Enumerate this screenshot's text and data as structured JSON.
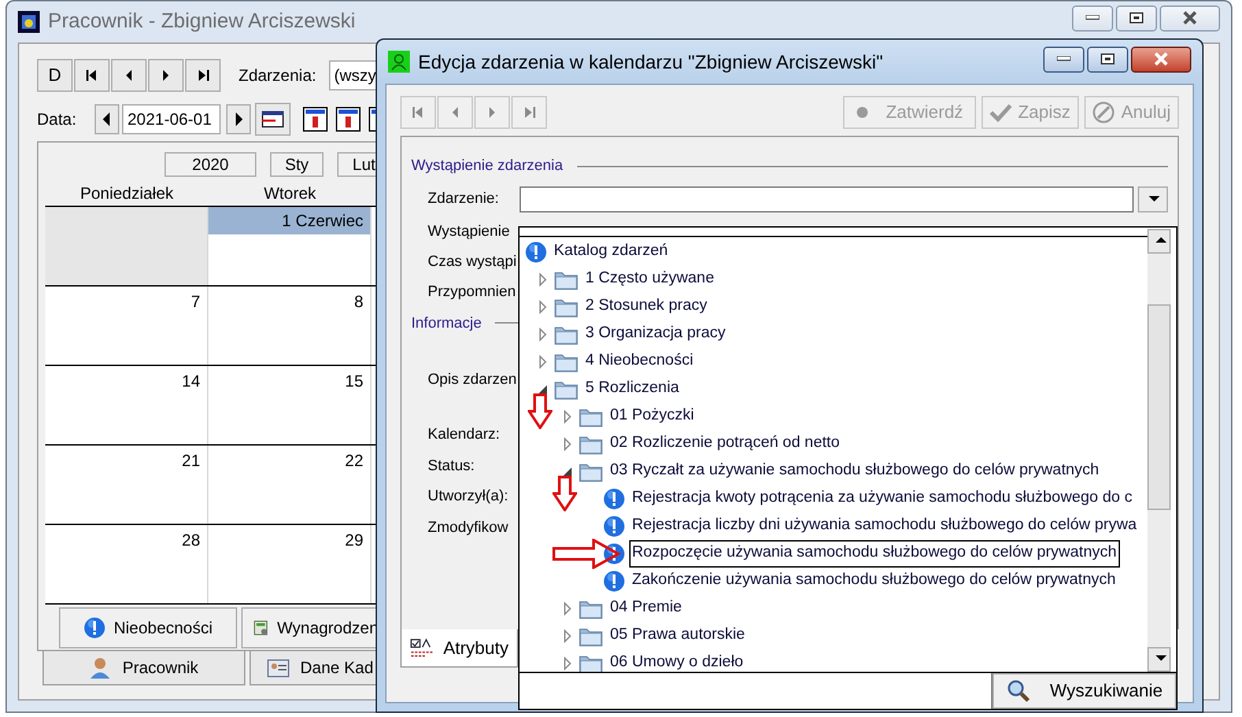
{
  "main_window": {
    "title": "Pracownik - Zbigniew Arciszewski",
    "toolbar": {
      "new_label": "D",
      "events_label": "Zdarzenia:",
      "events_value": "(wszy"
    },
    "date_row": {
      "label": "Data:",
      "value": "2021-06-01"
    },
    "calendar": {
      "year": "2020",
      "months": [
        "Sty",
        "Lut"
      ],
      "weekdays": [
        "Poniedziałek",
        "Wtorek"
      ],
      "weeks": [
        [
          {
            "kind": "outside"
          },
          {
            "label": "1 Czerwiec",
            "kind": "current"
          }
        ],
        [
          {
            "label": "7",
            "kind": "day"
          },
          {
            "label": "8",
            "kind": "day"
          }
        ],
        [
          {
            "label": "14",
            "kind": "day"
          },
          {
            "label": "15",
            "kind": "day"
          }
        ],
        [
          {
            "label": "21",
            "kind": "day"
          },
          {
            "label": "22",
            "kind": "day"
          }
        ],
        [
          {
            "label": "28",
            "kind": "day"
          },
          {
            "label": "29",
            "kind": "day"
          }
        ]
      ]
    },
    "buttons": [
      "Nieobecności",
      "Wynagrodzen"
    ],
    "tabs": [
      {
        "label": "Pracownik",
        "selected": false
      },
      {
        "label": "Dane Kad",
        "selected": false
      }
    ]
  },
  "dialog": {
    "title": "Edycja zdarzenia w kalendarzu \"Zbigniew Arciszewski\"",
    "actions": [
      {
        "label": "Zatwierdź",
        "kind": "confirm",
        "disabled": true
      },
      {
        "label": "Zapisz",
        "kind": "save",
        "disabled": true
      },
      {
        "label": "Anuluj",
        "kind": "cancel",
        "disabled": true
      }
    ],
    "section_1": {
      "title": "Wystąpienie zdarzenia",
      "labels": [
        "Zdarzenie:",
        "Wystąpienie",
        "Czas wystąpi",
        "Przypomnien"
      ]
    },
    "section_2": {
      "title": "Informacje",
      "labels": [
        "Opis zdarzen",
        "Kalendarz:",
        "Status:",
        "Utworzył(a):",
        "Zmodyfikow"
      ]
    },
    "tab": "Atrybuty"
  },
  "tree": {
    "items": [
      {
        "label": "Katalog zdarzeń",
        "kind": "root",
        "selected": false,
        "children": [
          {
            "label": "1 Często używane",
            "kind": "folder",
            "expanded": false,
            "selected": false
          },
          {
            "label": "2 Stosunek pracy",
            "kind": "folder",
            "expanded": false,
            "selected": false
          },
          {
            "label": "3 Organizacja pracy",
            "kind": "folder",
            "expanded": false,
            "selected": false
          },
          {
            "label": "4 Nieobecności",
            "kind": "folder",
            "expanded": false,
            "selected": false
          },
          {
            "label": "5 Rozliczenia",
            "kind": "folder",
            "expanded": true,
            "selected": false,
            "children": [
              {
                "label": "01 Pożyczki",
                "kind": "folder",
                "expanded": false,
                "selected": false,
                "annotation": {
                  "kind": "down_arrow"
                }
              },
              {
                "label": "02 Rozliczenie potrąceń od netto",
                "kind": "folder",
                "expanded": false,
                "selected": false
              },
              {
                "label": "03 Ryczałt za używanie samochodu służbowego do celów prywatnych",
                "kind": "folder",
                "expanded": true,
                "selected": false,
                "children": [
                  {
                    "label": "Rejestracja kwoty potrącenia za używanie samochodu służbowego do c",
                    "kind": "event",
                    "selected": false,
                    "annotation": {
                      "kind": "down_arrow"
                    }
                  },
                  {
                    "label": "Rejestracja liczby dni używania samochodu służbowego do celów prywa",
                    "kind": "event",
                    "selected": false
                  },
                  {
                    "label": "Rozpoczęcie używania samochodu służbowego do celów prywatnych",
                    "kind": "event",
                    "selected": true,
                    "annotation": {
                      "kind": "right_arrow"
                    }
                  },
                  {
                    "label": "Zakończenie używania samochodu służbowego do celów prywatnych",
                    "kind": "event",
                    "selected": false
                  }
                ]
              },
              {
                "label": "04 Premie",
                "kind": "folder",
                "expanded": false,
                "selected": false
              },
              {
                "label": "05 Prawa autorskie",
                "kind": "folder",
                "expanded": false,
                "selected": false
              },
              {
                "label": "06 Umowy o dzieło",
                "kind": "folder",
                "expanded": false,
                "selected": false
              }
            ]
          }
        ]
      }
    ]
  },
  "search_button": "Wyszukiwanie"
}
